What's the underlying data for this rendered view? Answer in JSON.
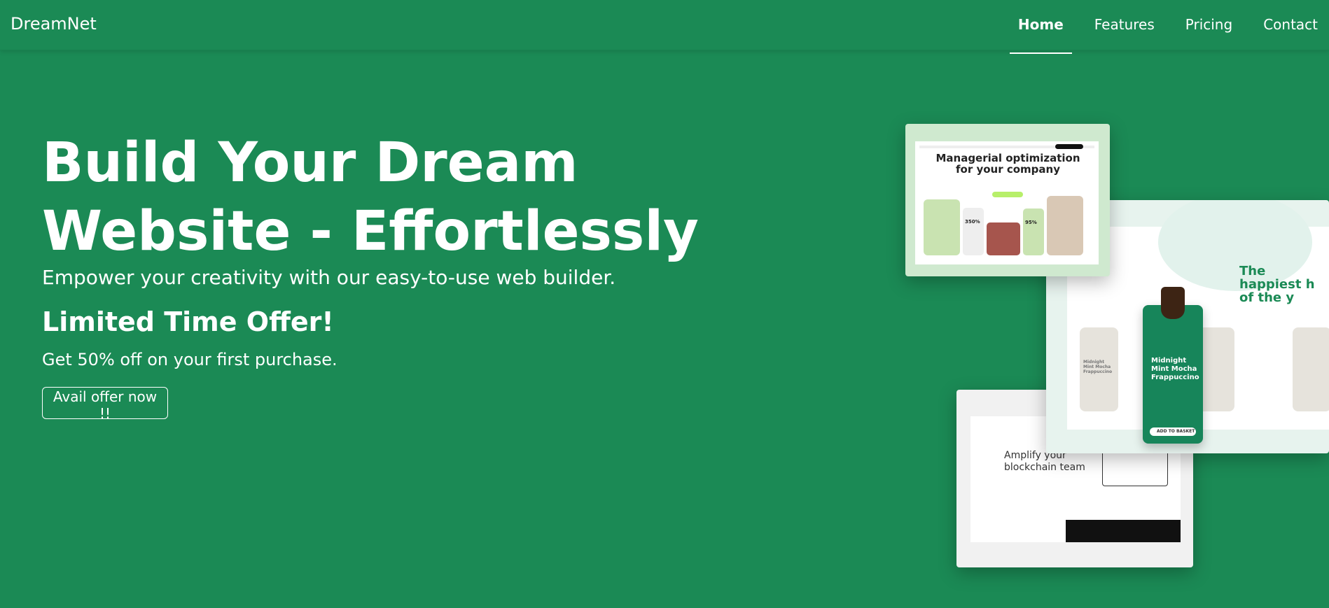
{
  "brand": "DreamNet",
  "nav": {
    "items": [
      {
        "label": "Home",
        "active": true
      },
      {
        "label": "Features",
        "active": false
      },
      {
        "label": "Pricing",
        "active": false
      },
      {
        "label": "Contact",
        "active": false
      }
    ]
  },
  "hero": {
    "title": "Build Your Dream Website - Effortlessly",
    "subtitle": "Empower your creativity with our easy-to-use web builder.",
    "offer_title": "Limited Time Offer!",
    "offer_text": "Get 50% off on your first purchase.",
    "cta_label": "Avail offer now !!"
  },
  "mockups": {
    "m1_heading": "Managerial optimization for your company",
    "m1_stat1": "350%",
    "m1_stat2": "95%",
    "m2_heading": "The happiest h of the y",
    "m2_card_title": "Midnight Mint Mocha Frappuccino",
    "m2_small_label": "Midnight Mint Mocha Frappuccino",
    "m2_button": "ADD TO BASKET",
    "m3_heading": "Amplify your blockchain team"
  },
  "colors": {
    "brand_green": "#1b8a55",
    "card_green": "#17855a",
    "mockup_light": "#cfe9cf"
  }
}
